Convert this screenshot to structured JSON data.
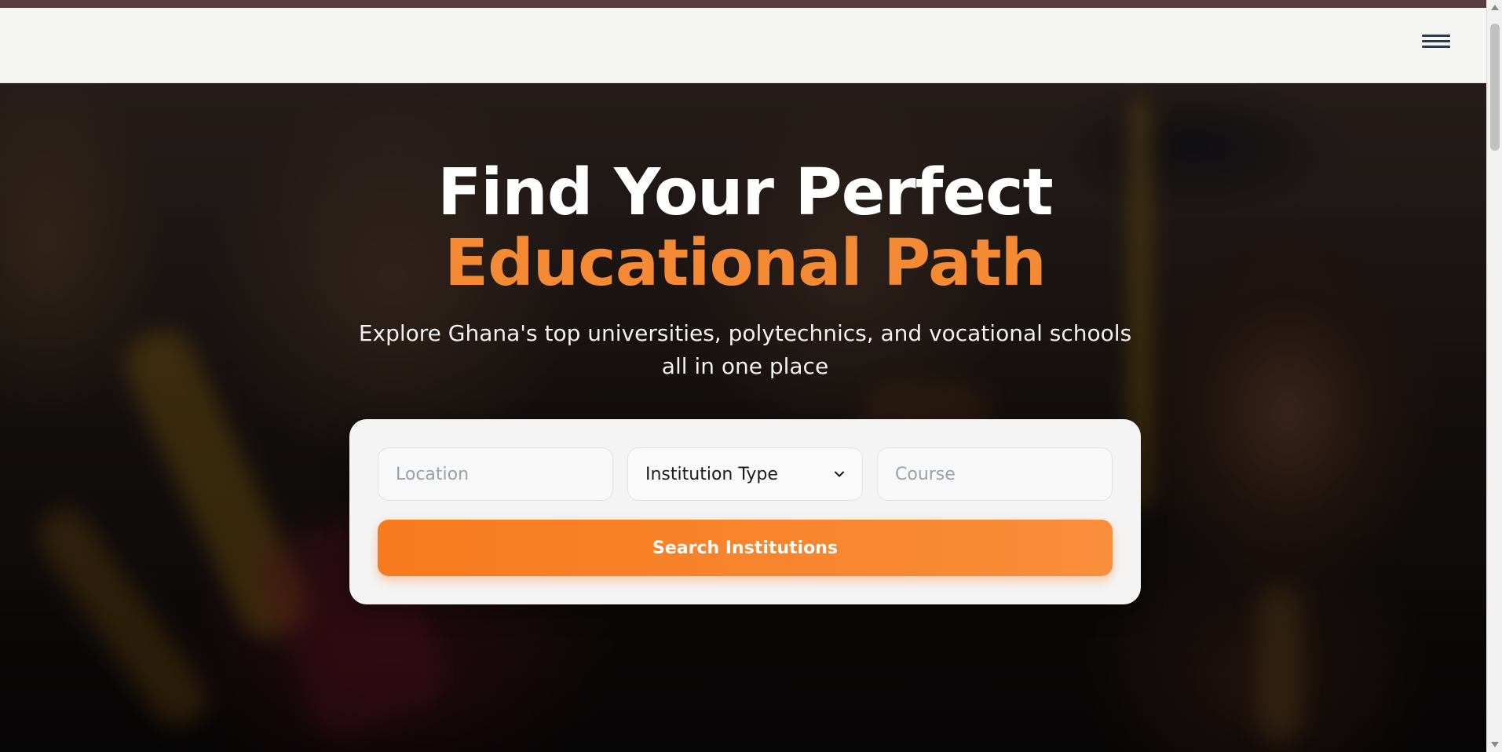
{
  "navbar": {
    "menu_icon": "hamburger-menu-icon"
  },
  "hero": {
    "headline_line1": "Find Your Perfect",
    "headline_line2": "Educational Path",
    "subtitle": "Explore Ghana's top universities, polytechnics, and vocational schools all in one place"
  },
  "search": {
    "location_placeholder": "Location",
    "institution_type_value": "Institution Type",
    "institution_type_icon": "chevron-down-icon",
    "course_placeholder": "Course",
    "button_label": "Search Institutions"
  },
  "colors": {
    "accent": "#f58a35",
    "button_start": "#f77a1d",
    "button_end": "#f98e3c",
    "top_strip": "#5a3a40",
    "navbar_bg": "#f5f5f4"
  }
}
